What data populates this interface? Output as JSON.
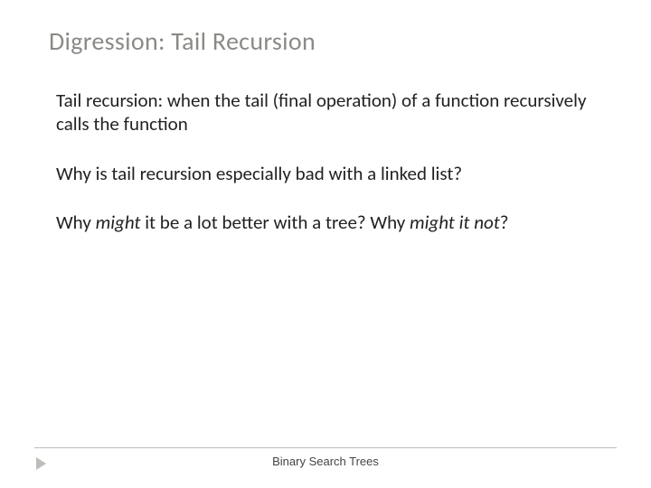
{
  "title": "Digression: Tail Recursion",
  "bullets": [
    {
      "pre": "Tail recursion: when the tail (final operation) of a function recursively calls the function"
    },
    {
      "pre": "Why is tail recursion especially bad with a linked list?"
    },
    {
      "pre": "Why ",
      "em1": "might",
      "mid": " it be a lot better with a tree?  Why ",
      "em2": "might it not",
      "post": "?"
    }
  ],
  "footer": "Binary Search Trees"
}
